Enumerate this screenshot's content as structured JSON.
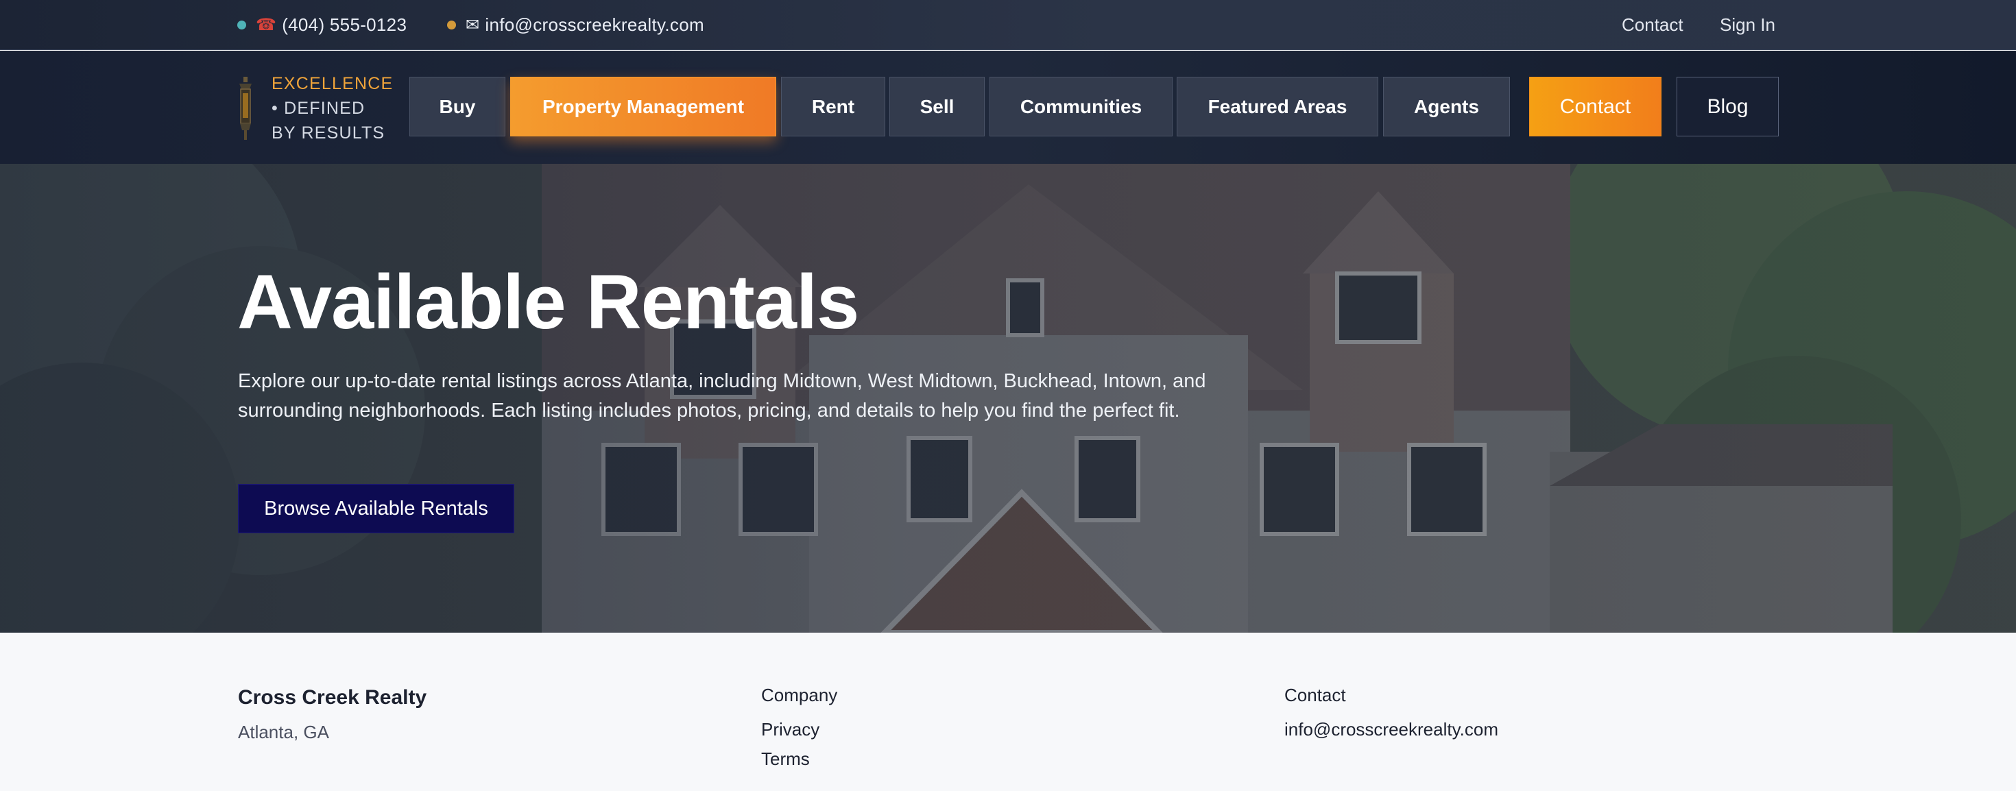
{
  "topbar": {
    "phone": "(404) 555-0123",
    "phone_icon": "telephone-icon",
    "email": "info@crosscreekrealty.com",
    "email_icon": "envelope-icon",
    "links": [
      "Contact",
      "Sign In"
    ],
    "dot_colors": [
      "#4fb3b8",
      "#d49a3a"
    ]
  },
  "brand": {
    "line1": "EXCELLENCE",
    "line2": "• DEFINED",
    "line3": "BY RESULTS",
    "icon": "lantern-icon"
  },
  "nav": {
    "items": [
      "Buy",
      "Property Management",
      "Rent",
      "Sell",
      "Communities",
      "Featured Areas",
      "Agents"
    ],
    "active": "Property Management",
    "contact": "Contact",
    "blog": "Blog"
  },
  "hero": {
    "title": "Available Rentals",
    "description": "Explore our up-to-date rental listings across Atlanta, including Midtown, West Midtown, Buckhead, Intown, and surrounding neighborhoods. Each listing includes photos, pricing, and details to help you find the perfect fit.",
    "cta": "Browse Available Rentals"
  },
  "footer": {
    "company_name": "Cross Creek Realty",
    "location": "Atlanta, GA",
    "company_heading": "Company",
    "company_links": [
      "Privacy",
      "Terms"
    ],
    "contact_heading": "Contact",
    "contact_email": "info@crosscreekrealty.com"
  },
  "colors": {
    "accent_orange": "#f07a26",
    "cta_navy": "#0d0b52",
    "nav_bg": "#1f283b"
  }
}
